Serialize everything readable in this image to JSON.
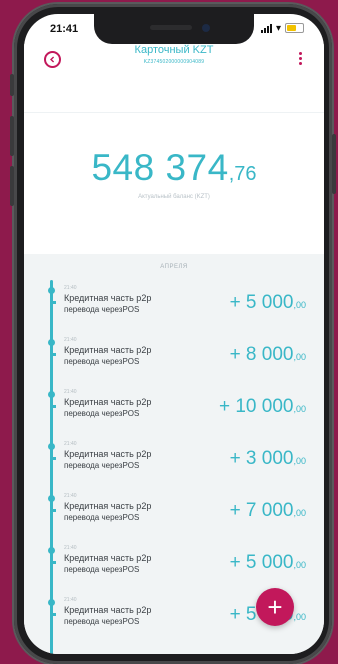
{
  "status_bar": {
    "time": "21:41"
  },
  "header": {
    "title": "Карточный KZT",
    "account_number": "KZ374502000000904089"
  },
  "balance": {
    "integer": "548 374",
    "decimal": ",76",
    "label": "Актуальный баланс (KZT)"
  },
  "transactions": {
    "date_label": "АПРЕЛЯ",
    "items": [
      {
        "time": "21:40",
        "title": "Кредитная часть p2p",
        "subtitle": "перевода черезPOS",
        "amount_int": "+ 5 000",
        "amount_dec": ",00"
      },
      {
        "time": "21:40",
        "title": "Кредитная часть p2p",
        "subtitle": "перевода черезPOS",
        "amount_int": "+ 8 000",
        "amount_dec": ",00"
      },
      {
        "time": "21:40",
        "title": "Кредитная часть p2p",
        "subtitle": "перевода черезPOS",
        "amount_int": "+ 10 000",
        "amount_dec": ",00"
      },
      {
        "time": "21:40",
        "title": "Кредитная часть p2p",
        "subtitle": "перевода черезPOS",
        "amount_int": "+ 3 000",
        "amount_dec": ",00"
      },
      {
        "time": "21:40",
        "title": "Кредитная часть p2p",
        "subtitle": "перевода черезPOS",
        "amount_int": "+ 7 000",
        "amount_dec": ",00"
      },
      {
        "time": "21:40",
        "title": "Кредитная часть p2p",
        "subtitle": "перевода черезPOS",
        "amount_int": "+ 5 000",
        "amount_dec": ",00"
      },
      {
        "time": "21:40",
        "title": "Кредитная часть p2p",
        "subtitle": "перевода черезPOS",
        "amount_int": "+ 5 000",
        "amount_dec": ",00"
      }
    ]
  },
  "fab": {
    "label": "+"
  },
  "colors": {
    "accent": "#39b7c7",
    "brand": "#c2185b",
    "background": "#8e1a4c"
  },
  "icons": {
    "back": "back-circle-icon",
    "menu": "kebab-menu-icon",
    "add": "plus-icon"
  }
}
